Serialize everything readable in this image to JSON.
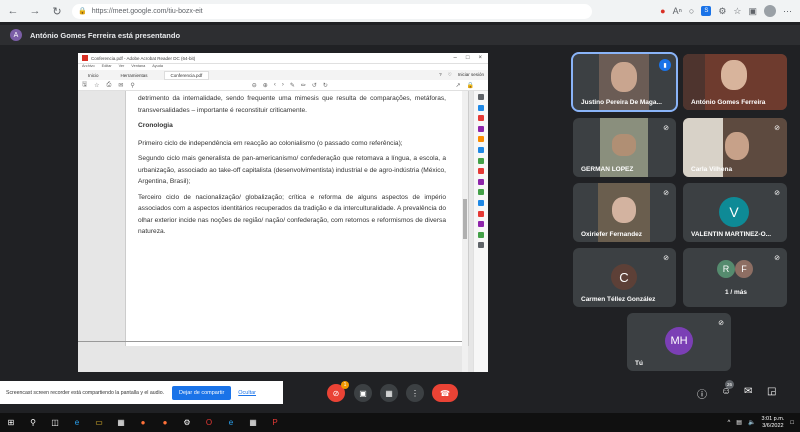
{
  "browser": {
    "url": "https://meet.google.com/tiu-bozx-eit"
  },
  "banner": {
    "avatar_letter": "A",
    "text": "António Gomes Ferreira está presentando"
  },
  "shared_window": {
    "title": "Conferencia.pdf - Adobe Acrobat Reader DC (64-bit)",
    "menu": [
      "Archivo",
      "Editar",
      "Ver",
      "Ventana",
      "Ayuda"
    ],
    "tabs": [
      "Inicio",
      "Herramientas",
      "Conferencia.pdf"
    ],
    "signin": "Iniciar sesión",
    "document": {
      "line_top": "detrimento da internalidade, sendo frequente uma mimesis que resulta de comparações, metáforas, transversalidades – importante é reconstituir criticamente.",
      "heading": "Cronologia",
      "p1": "Primeiro ciclo de independência em reacção ao colonialismo (o passado como referência);",
      "p2": "Segundo ciclo mais generalista de pan-americanismo/ confederação que retomava a língua, a escola, a urbanização, associado ao take-off capitalista (desenvolvimentista) industrial e de agro-indústria (México, Argentina, Brasil);",
      "p3": "Terceiro ciclo de nacionalização/ globalização; crítica e reforma de alguns aspectos de império associados com a aspectos identitários recuperados da tradição e da interculturalidade. A prevalência do olhar exterior incide nas noções de região/ nação/ confederação, com retornos e reformismos de diversa natureza."
    }
  },
  "participants": [
    {
      "name": "Justino Pereira De Maga...",
      "type": "video",
      "speaking": true
    },
    {
      "name": "António Gomes Ferreira",
      "type": "video"
    },
    {
      "name": "GERMAN LOPEZ",
      "type": "video",
      "muted": true
    },
    {
      "name": "Carla Vilhena",
      "type": "video",
      "muted": true
    },
    {
      "name": "Oxiriefer Fernandez",
      "type": "video",
      "muted": true
    },
    {
      "name": "VALENTIN MARTINEZ-O...",
      "type": "avatar",
      "letter": "V",
      "color": "#0e8a96",
      "muted": true
    },
    {
      "name": "Carmen Téllez González",
      "type": "avatar",
      "letter": "C",
      "color": "#5d4037",
      "muted": true
    },
    {
      "name": "1 / más",
      "type": "group",
      "letters": [
        "R",
        "F"
      ],
      "colors": [
        "#558b6e",
        "#8d6e63"
      ],
      "muted": true
    },
    {
      "name": "Tú",
      "type": "avatar",
      "letter": "MH",
      "color": "#7b3fb5",
      "muted": true
    }
  ],
  "screen_recorder": {
    "text": "Screencast screen recorder está compartiendo la pantalla y el audio.",
    "share_label": "Dejar de compartir",
    "hide_label": "Ocultar"
  },
  "controls": {
    "notification_count": "1",
    "people_count": "26"
  },
  "taskbar": {
    "time": "3:01 p.m.",
    "date": "3/6/2022"
  },
  "colors": {
    "meet_bg": "#202124",
    "tile_bg": "#3c4043",
    "end_call": "#ea4335",
    "accent": "#1a73e8"
  }
}
